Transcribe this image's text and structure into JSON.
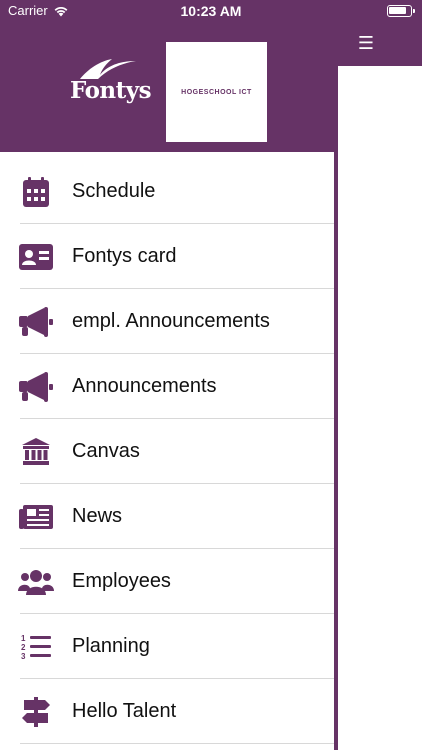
{
  "status_bar": {
    "carrier": "Carrier",
    "time": "10:23 AM"
  },
  "header": {
    "logo_text": "Fontys",
    "school_label": "HOGESCHOOL ICT"
  },
  "menu": {
    "items": [
      {
        "label": "Schedule",
        "icon": "calendar-icon"
      },
      {
        "label": "Fontys card",
        "icon": "id-card-icon"
      },
      {
        "label": "empl. Announcements",
        "icon": "megaphone-icon"
      },
      {
        "label": "Announcements",
        "icon": "megaphone-icon"
      },
      {
        "label": "Canvas",
        "icon": "institution-icon"
      },
      {
        "label": "News",
        "icon": "newspaper-icon"
      },
      {
        "label": "Employees",
        "icon": "users-icon"
      },
      {
        "label": "Planning",
        "icon": "numbered-list-icon"
      },
      {
        "label": "Hello Talent",
        "icon": "signpost-icon"
      }
    ]
  },
  "nav": {
    "menu_icon": "☰"
  },
  "colors": {
    "brand": "#663366",
    "background": "#ffffff",
    "divider": "#d8d8d8",
    "text": "#111111"
  }
}
